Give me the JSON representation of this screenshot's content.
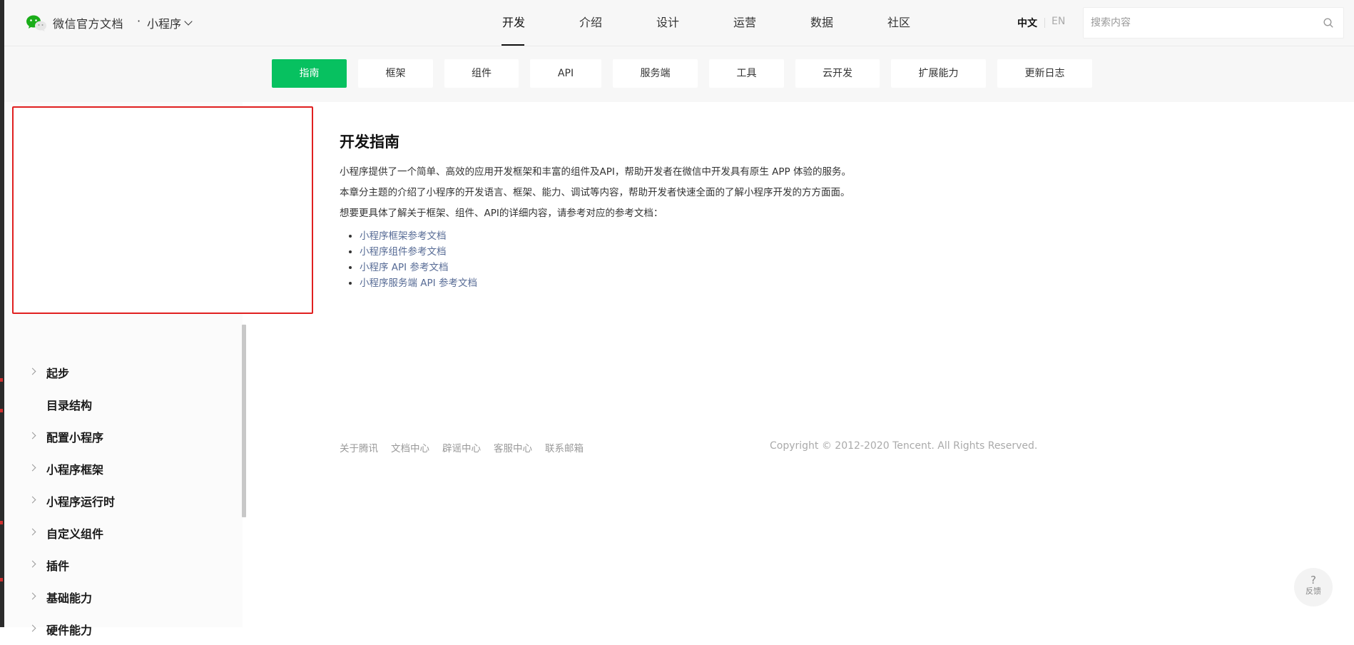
{
  "header": {
    "brand": "微信官方文档",
    "separator": "·",
    "product": "小程序",
    "nav": [
      "开发",
      "介绍",
      "设计",
      "运营",
      "数据",
      "社区"
    ],
    "lang_zh": "中文",
    "lang_en": "EN",
    "search_placeholder": "搜索内容"
  },
  "subtabs": [
    "指南",
    "框架",
    "组件",
    "API",
    "服务端",
    "工具",
    "云开发",
    "扩展能力",
    "更新日志"
  ],
  "sidebar": {
    "items": [
      {
        "label": "起步",
        "expandable": true
      },
      {
        "label": "目录结构",
        "expandable": false
      },
      {
        "label": "配置小程序",
        "expandable": true
      },
      {
        "label": "小程序框架",
        "expandable": true
      },
      {
        "label": "小程序运行时",
        "expandable": true
      },
      {
        "label": "自定义组件",
        "expandable": true
      },
      {
        "label": "插件",
        "expandable": true
      },
      {
        "label": "基础能力",
        "expandable": true
      },
      {
        "label": "硬件能力",
        "expandable": true
      }
    ]
  },
  "main": {
    "title": "开发指南",
    "paragraphs": [
      "小程序提供了一个简单、高效的应用开发框架和丰富的组件及API，帮助开发者在微信中开发具有原生 APP 体验的服务。",
      "本章分主题的介绍了小程序的开发语言、框架、能力、调试等内容，帮助开发者快速全面的了解小程序开发的方方面面。",
      "想要更具体了解关于框架、组件、API的详细内容，请参考对应的参考文档："
    ],
    "links": [
      "小程序框架参考文档",
      "小程序组件参考文档",
      "小程序 API 参考文档",
      "小程序服务端 API 参考文档"
    ]
  },
  "footer": {
    "links": [
      "关于腾讯",
      "文档中心",
      "辟谣中心",
      "客服中心",
      "联系邮箱"
    ],
    "copyright": "Copyright © 2012-2020 Tencent. All Rights Reserved."
  },
  "feedback": {
    "icon": "?",
    "label": "反馈"
  },
  "colors": {
    "accent": "#07c160",
    "link": "#576b95",
    "highlight_border": "#e02020"
  }
}
